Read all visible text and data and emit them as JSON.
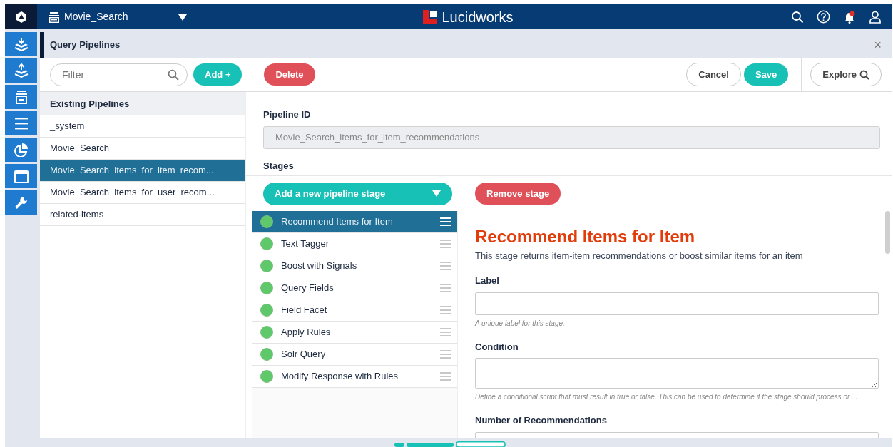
{
  "topbar": {
    "collection": "Movie_Search",
    "brand": "Lucidworks",
    "notification_alert": true
  },
  "panel": {
    "title": "Query Pipelines",
    "close": "×"
  },
  "toolbar": {
    "filter_placeholder": "Filter",
    "add": "Add +",
    "delete": "Delete",
    "cancel": "Cancel",
    "save": "Save",
    "explore": "Explore"
  },
  "pipelines": {
    "heading": "Existing Pipelines",
    "items": [
      {
        "label": "_system",
        "selected": false
      },
      {
        "label": "Movie_Search",
        "selected": false
      },
      {
        "label": "Movie_Search_items_for_item_recom...",
        "selected": true
      },
      {
        "label": "Movie_Search_items_for_user_recom...",
        "selected": false
      },
      {
        "label": "related-items",
        "selected": false
      }
    ]
  },
  "pipeline_id": {
    "label": "Pipeline ID",
    "value": "Movie_Search_items_for_item_recommendations",
    "disabled": true
  },
  "stages": {
    "heading": "Stages",
    "add": "Add a new pipeline stage",
    "remove": "Remove stage",
    "items": [
      {
        "label": "Recommend Items for Item",
        "selected": true,
        "color": "#5fc86a"
      },
      {
        "label": "Text Tagger",
        "selected": false,
        "color": "#5fc86a"
      },
      {
        "label": "Boost with Signals",
        "selected": false,
        "color": "#5fc86a"
      },
      {
        "label": "Query Fields",
        "selected": false,
        "color": "#5fc86a"
      },
      {
        "label": "Field Facet",
        "selected": false,
        "color": "#5fc86a"
      },
      {
        "label": "Apply Rules",
        "selected": false,
        "color": "#5fc86a"
      },
      {
        "label": "Solr Query",
        "selected": false,
        "color": "#5fc86a"
      },
      {
        "label": "Modify Response with Rules",
        "selected": false,
        "color": "#5fc86a"
      }
    ]
  },
  "stage_detail": {
    "title": "Recommend Items for Item",
    "description": "This stage returns item-item recommendations or boost similar items for an item",
    "fields": [
      {
        "kind": "input",
        "label": "Label",
        "hint": "A unique label for this stage."
      },
      {
        "kind": "textarea",
        "label": "Condition",
        "hint": "Define a conditional script that must result in true or false. This can be used to determine if the stage should process or ..."
      },
      {
        "kind": "input",
        "label": "Number of Recommendations"
      }
    ]
  }
}
